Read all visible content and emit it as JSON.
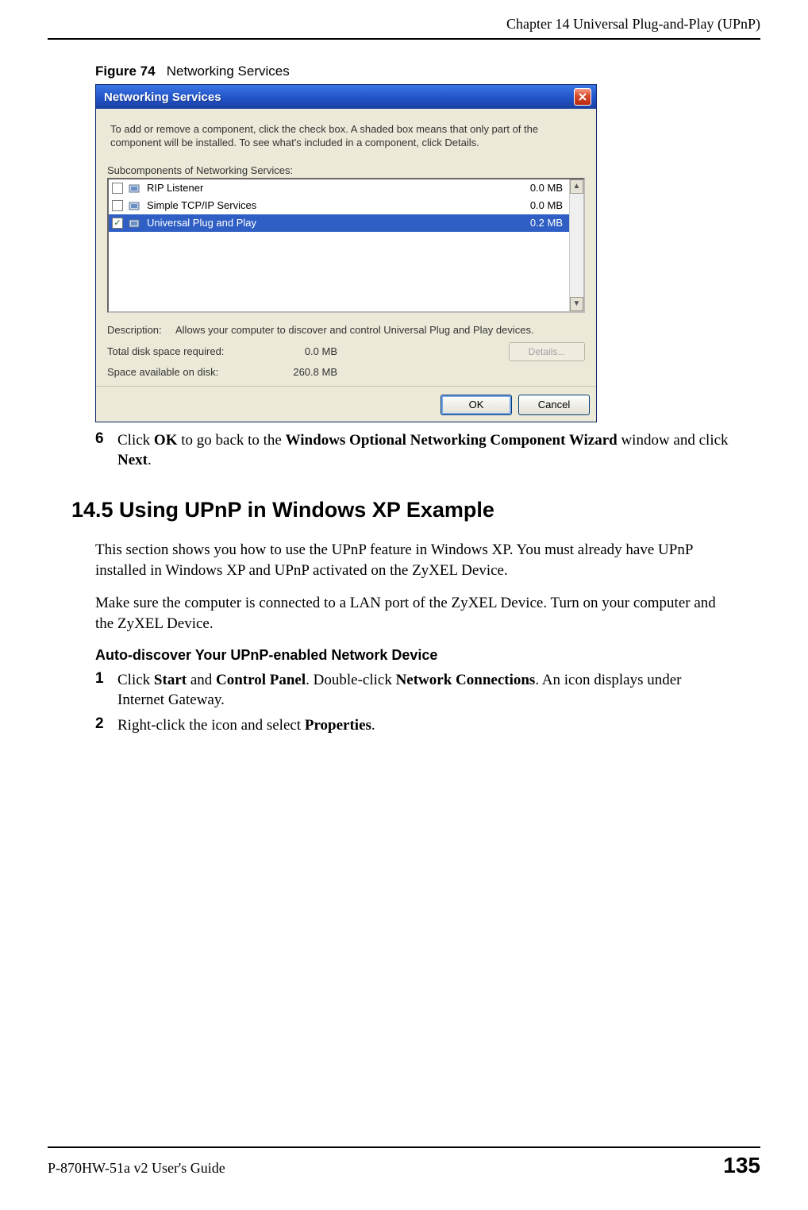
{
  "header": {
    "chapter": "Chapter 14 Universal Plug-and-Play (UPnP)"
  },
  "figure": {
    "label": "Figure 74",
    "caption": "Networking Services"
  },
  "dialog": {
    "title": "Networking Services",
    "intro": "To add or remove a component, click the check box. A shaded box means that only part of the component will be installed. To see what's included in a component, click Details.",
    "sub_label": "Subcomponents of Networking Services:",
    "items": [
      {
        "checked": false,
        "name": "RIP Listener",
        "size": "0.0 MB",
        "selected": false
      },
      {
        "checked": false,
        "name": "Simple TCP/IP Services",
        "size": "0.0 MB",
        "selected": false
      },
      {
        "checked": true,
        "name": "Universal Plug and Play",
        "size": "0.2 MB",
        "selected": true
      }
    ],
    "description_label": "Description:",
    "description_text": "Allows your computer to discover and control Universal Plug and Play devices.",
    "total_label": "Total disk space required:",
    "total_value": "0.0 MB",
    "avail_label": "Space available on disk:",
    "avail_value": "260.8 MB",
    "details_btn": "Details...",
    "ok_btn": "OK",
    "cancel_btn": "Cancel"
  },
  "step6": {
    "num": "6",
    "text_pre": "Click ",
    "b1": "OK",
    "text_mid1": " to go back to the ",
    "b2": "Windows Optional Networking Component Wizard",
    "text_mid2": " window and click ",
    "b3": "Next",
    "text_post": "."
  },
  "section": {
    "heading": "14.5  Using UPnP in Windows XP Example",
    "para1": "This section shows you how to use the UPnP feature in Windows XP. You must already have UPnP installed in Windows XP and UPnP activated on the ZyXEL Device.",
    "para2": "Make sure the computer is connected to a LAN port of the ZyXEL Device. Turn on your computer and the ZyXEL Device.",
    "subhead": "Auto-discover Your UPnP-enabled Network Device",
    "steps": [
      {
        "num": "1",
        "pre": "Click ",
        "b1": "Start",
        "mid1": " and ",
        "b2": "Control Panel",
        "mid2": ". Double-click ",
        "b3": "Network Connections",
        "post": ". An icon displays under Internet Gateway."
      },
      {
        "num": "2",
        "pre": "Right-click the icon and select ",
        "b1": "Properties",
        "mid1": "",
        "b2": "",
        "mid2": "",
        "b3": "",
        "post": "."
      }
    ]
  },
  "footer": {
    "guide": "P-870HW-51a v2 User's Guide",
    "page": "135"
  }
}
